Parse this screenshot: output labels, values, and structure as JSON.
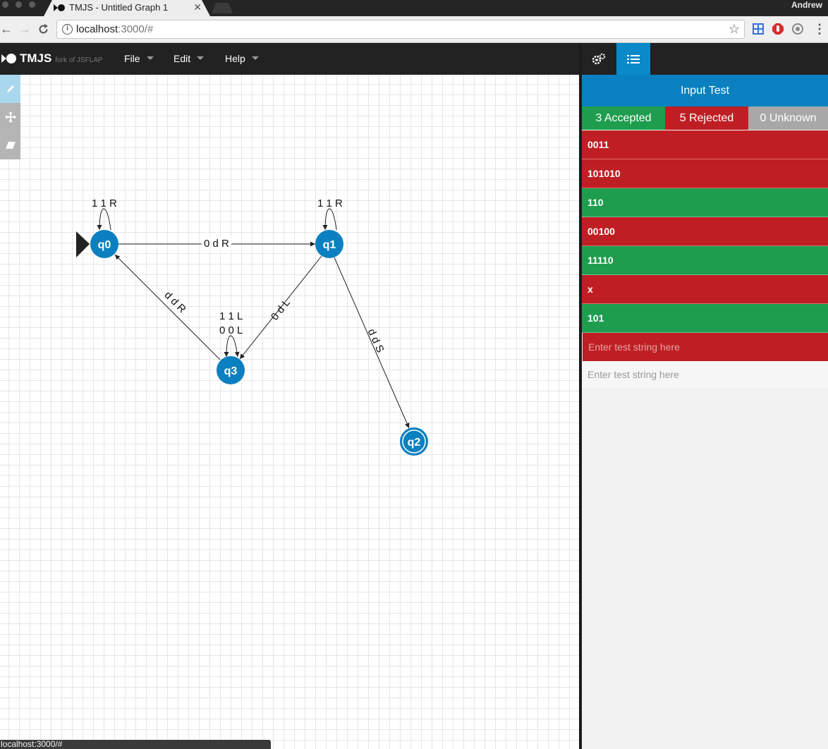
{
  "browser": {
    "tab_title": "TMJS - Untitled Graph 1",
    "tab_close": "✕",
    "url_host": "localhost",
    "url_rest": ":3000/#",
    "user": "Andrew",
    "status_url": "localhost:3000/#"
  },
  "app": {
    "title": "TMJS",
    "subtitle": "fork of JSFLAP",
    "menu": {
      "file": "File",
      "edit": "Edit",
      "help": "Help"
    }
  },
  "tools": [
    "pencil-icon",
    "move-icon",
    "eraser-icon"
  ],
  "graph": {
    "states": [
      {
        "id": "q0",
        "label": "q0",
        "initial": true,
        "accepting": false
      },
      {
        "id": "q1",
        "label": "q1",
        "initial": false,
        "accepting": false
      },
      {
        "id": "q3",
        "label": "q3",
        "initial": false,
        "accepting": false
      },
      {
        "id": "q2",
        "label": "q2",
        "initial": false,
        "accepting": true
      }
    ],
    "edge_labels": {
      "q0_loop": "1 1 R",
      "q1_loop": "1 1 R",
      "q3_loop_1": "1 1 L",
      "q3_loop_2": "0 0 L",
      "q0_q1": "0 d R",
      "q3_q0": "d d R",
      "q1_q3": "0 d L",
      "q1_q2": "d d S"
    }
  },
  "panel": {
    "title": "Input Test",
    "accepted": "3 Accepted",
    "rejected": "5 Rejected",
    "unknown": "0 Unknown",
    "tests": [
      {
        "value": "0011",
        "status": "rejected"
      },
      {
        "value": "101010",
        "status": "rejected"
      },
      {
        "value": "110",
        "status": "accepted"
      },
      {
        "value": "00100",
        "status": "rejected"
      },
      {
        "value": "11110",
        "status": "accepted"
      },
      {
        "value": "x",
        "status": "rejected"
      },
      {
        "value": "101",
        "status": "accepted"
      }
    ],
    "placeholder": "Enter test string here"
  },
  "colors": {
    "state": "#0a80c0",
    "accepted": "#1f9d4e",
    "rejected": "#bf1f24",
    "unknown": "#a8a8a8"
  }
}
